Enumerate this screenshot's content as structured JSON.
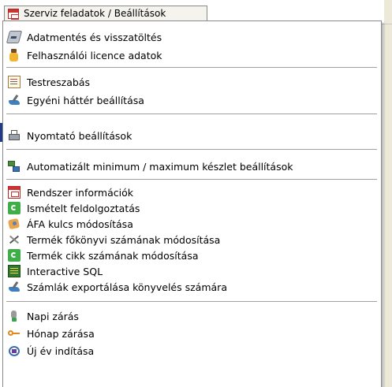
{
  "menu_title": "Szerviz feladatok / Beállítások",
  "groups": [
    {
      "items": [
        {
          "label": "Adatmentés és visszatöltés",
          "icon": "disk-icon"
        },
        {
          "label": "Felhasználói licence adatok",
          "icon": "license-bottle-icon"
        }
      ]
    },
    {
      "items": [
        {
          "label": "Testreszabás",
          "icon": "customize-doc-icon"
        },
        {
          "label": "Egyéni háttér beállítása",
          "icon": "paint-brush-icon"
        }
      ]
    },
    {
      "items": [
        {
          "label": "Nyomtató beállítások",
          "icon": "printer-icon"
        }
      ]
    },
    {
      "items": [
        {
          "label": "Automatizált minimum / maximum készlet beállítások",
          "icon": "network-icon"
        }
      ]
    },
    {
      "items": [
        {
          "label": "Rendszer információk",
          "icon": "window-icon"
        },
        {
          "label": "Ismételt feldolgoztatás",
          "icon": "refresh-icon"
        },
        {
          "label": "ÁFA kulcs módosítása",
          "icon": "vat-icon"
        },
        {
          "label": "Termék főkönyvi számának módosítása",
          "icon": "tools-icon"
        },
        {
          "label": "Termék cikk számának módosítása",
          "icon": "refresh-icon"
        },
        {
          "label": "Interactive SQL",
          "icon": "sql-icon"
        },
        {
          "label": "Számlák exportálása könyvelés számára",
          "icon": "paint-brush-icon"
        }
      ]
    },
    {
      "items": [
        {
          "label": "Napi zárás",
          "icon": "pin-icon"
        },
        {
          "label": "Hónap zárása",
          "icon": "key-icon"
        },
        {
          "label": "Új év indítása",
          "icon": "calendar-icon"
        }
      ]
    }
  ]
}
